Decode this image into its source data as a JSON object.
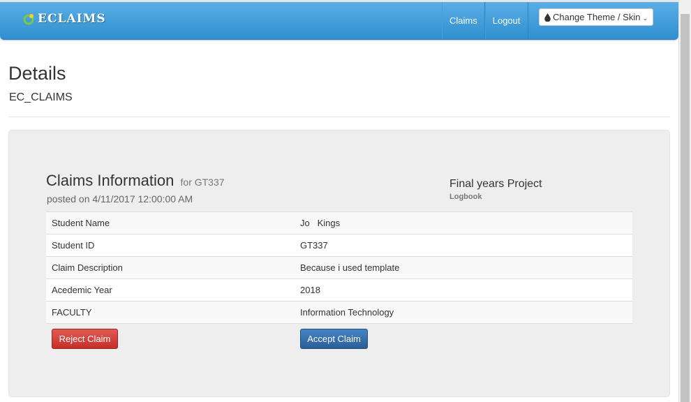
{
  "app": {
    "brand": "ECLAIMS"
  },
  "nav": {
    "links": [
      "Claims",
      "Logout"
    ],
    "theme_button": "Change Theme / Skin"
  },
  "page": {
    "title": "Details",
    "subtitle": "EC_CLAIMS"
  },
  "claim": {
    "heading": "Claims Information",
    "for_label": "for GT337",
    "posted": "posted on 4/11/2017 12:00:00 AM",
    "project_title": "Final years Project",
    "project_sub": "Logbook",
    "rows": [
      {
        "label": "Student Name",
        "value": "Jo   Kings"
      },
      {
        "label": "Student ID",
        "value": "GT337"
      },
      {
        "label": "Claim Description",
        "value": "Because i used template"
      },
      {
        "label": "Acedemic Year",
        "value": "2018"
      },
      {
        "label": "FACULTY",
        "value": "Information Technology"
      }
    ],
    "reject_label": "Reject Claim",
    "accept_label": "Accept Claim"
  },
  "colors": {
    "navbar": "#3d9bdc",
    "reject": "#d2403a",
    "accept": "#336fae",
    "well": "#eeeeee"
  }
}
